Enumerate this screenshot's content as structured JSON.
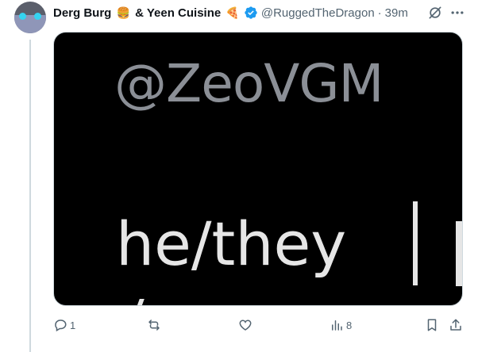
{
  "tweet": {
    "display_name": "Derg Burg",
    "name_emoji_1": "🍔",
    "name_middle": "& Yeen Cuisine",
    "name_emoji_2": "🍕",
    "handle": "@RuggedTheDragon",
    "separator": "·",
    "time": "39m"
  },
  "media": {
    "image_text_handle": "@ZeoVGM",
    "image_text_pronouns": "he/they"
  },
  "actions": {
    "reply_count": "1",
    "repost_count": "",
    "like_count": "",
    "views_count": "8"
  },
  "icons": {
    "header": [
      "verified-badge-icon",
      "grok-icon",
      "more-icon"
    ],
    "actions": [
      "reply-icon",
      "repost-icon",
      "like-icon",
      "views-icon",
      "bookmark-icon",
      "share-icon"
    ]
  },
  "colors": {
    "verified": "#1d9bf0",
    "secondary_text": "#536471",
    "thread_line": "#cfd9de"
  }
}
